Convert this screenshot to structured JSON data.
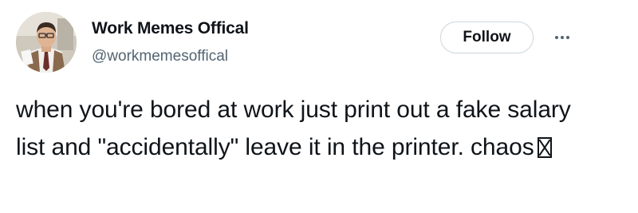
{
  "author": {
    "display_name": "Work Memes Offical",
    "handle": "@workmemesoffical",
    "avatar_icon": "profile-photo"
  },
  "actions": {
    "follow_label": "Follow",
    "more_icon": "more-horizontal-icon"
  },
  "tweet": {
    "text": "when you're bored at work just print out a fake salary list and \"accidentally\" leave it in the printer. chaos",
    "trailing_glyph": "missing-emoji-glyph"
  },
  "colors": {
    "text_primary": "#0f1419",
    "text_secondary": "#536471",
    "button_border": "#cfd9de"
  }
}
